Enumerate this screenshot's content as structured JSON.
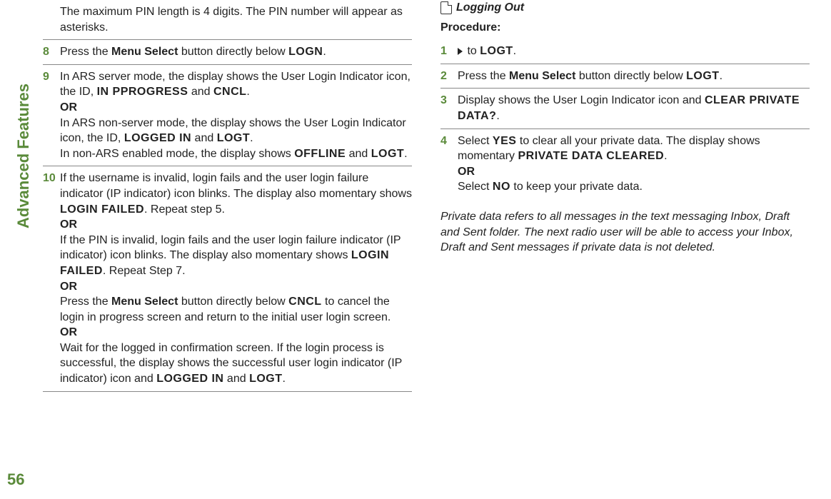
{
  "side_label": "Advanced Features",
  "page_number": "56",
  "left_intro": "The maximum PIN length is 4 digits. The PIN number will appear as asterisks.",
  "left": {
    "step8": {
      "num": "8",
      "a": "Press the ",
      "b": "Menu Select",
      "c": " button directly below ",
      "d": "LOGN",
      "e": "."
    },
    "step9": {
      "num": "9",
      "l1a": "In ARS server mode, the display shows the User Login Indicator icon, the ID, ",
      "l1b": "IN PPROGRESS",
      "l1c": " and ",
      "l1d": "CNCL",
      "l1e": ".",
      "or1": "OR",
      "l2a": "In ARS non-server mode, the display shows the User Login Indicator icon, the ID, ",
      "l2b": "LOGGED IN",
      "l2c": " and ",
      "l2d": "LOGT",
      "l2e": ".",
      "l3a": "In non-ARS enabled mode, the display shows ",
      "l3b": "OFFLINE",
      "l3c": " and ",
      "l3d": "LOGT",
      "l3e": "."
    },
    "step10": {
      "num": "10",
      "p1a": "If the username is invalid, login fails and the user login failure indicator (IP indicator) icon blinks. The display also momentary shows ",
      "p1b": "LOGIN FAILED",
      "p1c": ". Repeat step 5.",
      "or1": "OR",
      "p2a": "If the PIN is invalid, login fails and the user login failure indicator (IP indicator) icon blinks. The display also momentary shows ",
      "p2b": "LOGIN FAILED",
      "p2c": ". Repeat Step 7.",
      "or2": "OR",
      "p3a": "Press the ",
      "p3b": "Menu Select",
      "p3c": " button directly below ",
      "p3d": "CNCL",
      "p3e": " to cancel the login in progress screen and return to the initial user login screen.",
      "or3": "OR",
      "p4a": "Wait for the logged in confirmation screen. If the login process is successful, the display shows the successful user login indicator (IP indicator) icon and ",
      "p4b": "LOGGED IN",
      "p4c": " and ",
      "p4d": "LOGT",
      "p4e": "."
    }
  },
  "right": {
    "heading": "Logging Out",
    "procedure": "Procedure:",
    "step1": {
      "num": "1",
      "a": " to ",
      "b": "LOGT",
      "c": "."
    },
    "step2": {
      "num": "2",
      "a": "Press the ",
      "b": "Menu Select",
      "c": " button directly below ",
      "d": "LOGT",
      "e": "."
    },
    "step3": {
      "num": "3",
      "a": "Display shows the User Login Indicator icon and ",
      "b": "CLEAR PRIVATE DATA?",
      "c": "."
    },
    "step4": {
      "num": "4",
      "p1a": "Select ",
      "p1b": "YES",
      "p1c": " to clear all your private data. The display shows momentary ",
      "p1d": "PRIVATE DATA CLEARED",
      "p1e": ".",
      "or": "OR",
      "p2a": "Select ",
      "p2b": "NO",
      "p2c": " to keep your private data."
    },
    "note": "Private data refers to all messages in the text messaging Inbox, Draft and Sent folder. The next radio user will be able to access your Inbox, Draft and Sent messages if private data is not deleted."
  }
}
